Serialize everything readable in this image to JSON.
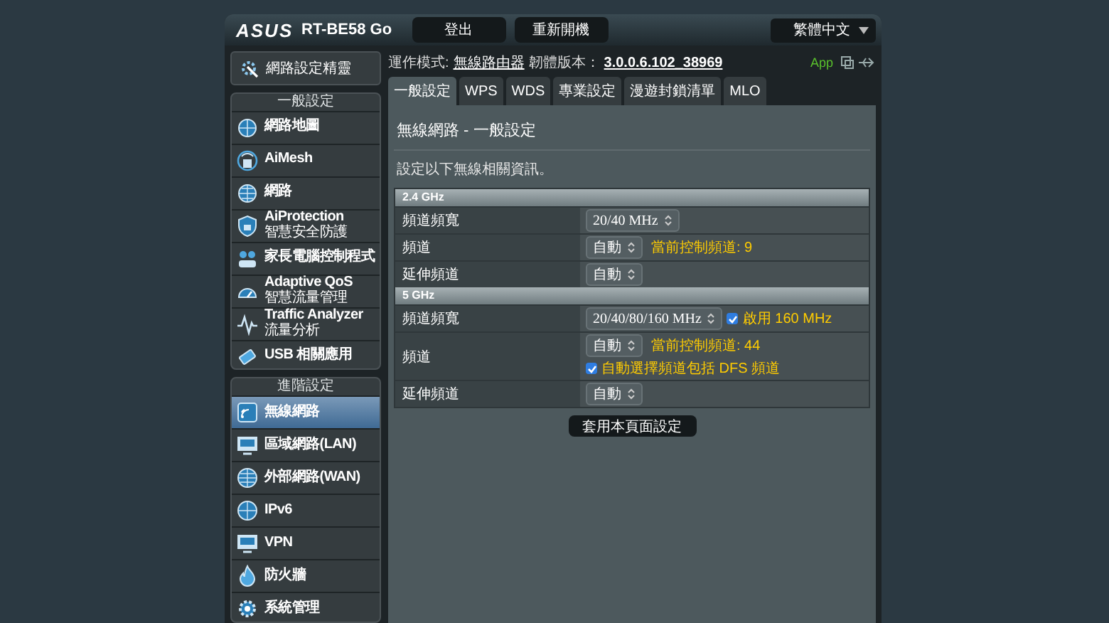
{
  "header": {
    "logo": "ASUS",
    "model": "RT-BE58 Go",
    "buttons": [
      "登出",
      "重新開機"
    ],
    "language": "繁體中文"
  },
  "status": {
    "mode_label": "運作模式:",
    "mode": "無線路由器",
    "firmware_label": "韌體版本：",
    "firmware": "3.0.0.6.102_38969",
    "app": "App"
  },
  "sidebar": {
    "wizard": "網路設定精靈",
    "sections": [
      {
        "title": "一般設定",
        "items": [
          {
            "label": "網路地圖",
            "selected": false
          },
          {
            "label": "AiMesh",
            "selected": false
          },
          {
            "label": "網路",
            "selected": false
          },
          {
            "label": "AiProtection",
            "sublabel": "智慧安全防護",
            "selected": false
          },
          {
            "label": "家長電腦控制程式",
            "selected": false
          },
          {
            "label": "Adaptive QoS",
            "sublabel": "智慧流量管理",
            "selected": false
          },
          {
            "label": "Traffic Analyzer",
            "sublabel": "流量分析",
            "selected": false
          },
          {
            "label": "USB 相關應用",
            "selected": false
          }
        ]
      },
      {
        "title": "進階設定",
        "items": [
          {
            "label": "無線網路",
            "selected": true
          },
          {
            "label": "區域網路(LAN)",
            "selected": false
          },
          {
            "label": "外部網路(WAN)",
            "selected": false
          },
          {
            "label": "IPv6",
            "selected": false
          },
          {
            "label": "VPN",
            "selected": false
          },
          {
            "label": "防火牆",
            "selected": false
          },
          {
            "label": "系統管理",
            "selected": false
          }
        ]
      }
    ]
  },
  "tabs": [
    {
      "label": "一般設定",
      "selected": true
    },
    {
      "label": "WPS",
      "selected": false
    },
    {
      "label": "WDS",
      "selected": false
    },
    {
      "label": "專業設定",
      "selected": false
    },
    {
      "label": "漫遊封鎖清單",
      "selected": false
    },
    {
      "label": "MLO",
      "selected": false
    }
  ],
  "page": {
    "title": "無線網路 - 一般設定",
    "description": "設定以下無線相關資訊。",
    "bands": [
      {
        "title": "2.4 GHz",
        "rows": [
          {
            "label": "頻道頻寬",
            "select": "20/40 MHz"
          },
          {
            "label": "頻道",
            "select": "自動",
            "note": "當前控制頻道: 9"
          },
          {
            "label": "延伸頻道",
            "select": "自動"
          }
        ]
      },
      {
        "title": "5 GHz",
        "rows": [
          {
            "label": "頻道頻寬",
            "select": "20/40/80/160 MHz",
            "checkbox": {
              "label": "啟用 160 MHz",
              "checked": true
            }
          },
          {
            "label": "頻道",
            "select": "自動",
            "note": "當前控制頻道: 44",
            "checkbox": {
              "label": "自動選擇頻道包括 DFS 頻道",
              "checked": true
            }
          },
          {
            "label": "延伸頻道",
            "select": "自動"
          }
        ]
      }
    ],
    "apply": "套用本頁面設定"
  }
}
